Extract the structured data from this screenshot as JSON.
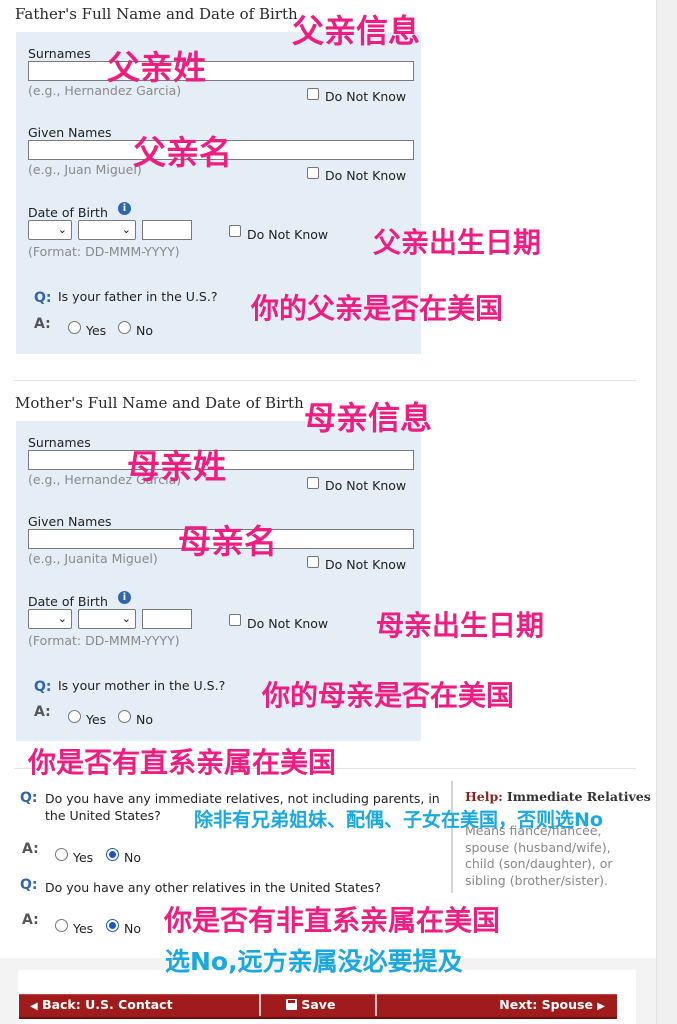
{
  "father": {
    "section_title": "Father's Full Name and Date of Birth",
    "surnames_label": "Surnames",
    "surnames_hint": "(e.g., Hernandez Garcia)",
    "given_label": "Given Names",
    "given_hint": "(e.g., Juan Miguel)",
    "dob_label": "Date of Birth",
    "dob_format": "(Format: DD-MMM-YYYY)",
    "do_not_know": "Do Not Know",
    "question": "Is your father in the U.S.?",
    "yes": "Yes",
    "no": "No"
  },
  "mother": {
    "section_title": "Mother's Full Name and Date of Birth",
    "surnames_label": "Surnames",
    "surnames_hint": "(e.g., Hernandez Garcia)",
    "given_label": "Given Names",
    "given_hint": "(e.g., Juanita Miguel)",
    "dob_label": "Date of Birth",
    "dob_format": "(Format: DD-MMM-YYYY)",
    "do_not_know": "Do Not Know",
    "question": "Is your mother in the U.S.?",
    "yes": "Yes",
    "no": "No"
  },
  "relatives": {
    "q1": "Do you have any immediate relatives, not including parents, in the United States?",
    "q1_yes": "Yes",
    "q1_no": "No",
    "q1_selected": "No",
    "q2": "Do you have any other relatives in the United States?",
    "q2_yes": "Yes",
    "q2_no": "No",
    "q2_selected": "No"
  },
  "qa": {
    "q": "Q:",
    "a": "A:"
  },
  "help": {
    "prefix": "Help:",
    "title": "Immediate Relatives",
    "body": "Means fiancé/fiancée, spouse (husband/wife), child (son/daughter), or sibling (brother/sister)."
  },
  "nav": {
    "back": "Back: U.S. Contact",
    "save": "Save",
    "next": "Next: Spouse"
  },
  "annotations": {
    "father_info": "父亲信息",
    "father_surname": "父亲姓",
    "father_given": "父亲名",
    "father_dob": "父亲出生日期",
    "father_in_us": "你的父亲是否在美国",
    "mother_info": "母亲信息",
    "mother_surname": "母亲姓",
    "mother_given": "母亲名",
    "mother_dob": "母亲出生日期",
    "mother_in_us": "你的母亲是否在美国",
    "immediate": "你是否有直系亲属在美国",
    "immediate_note": "除非有兄弟姐妹、配偶、子女在美国，否则选No",
    "other": "你是否有非直系亲属在美国",
    "other_note": "选No,远方亲属没必要提及"
  },
  "colors": {
    "annotation_pink": "#ee1d82",
    "annotation_blue": "#19a8e0",
    "nav_red": "#a01c1c",
    "panel_blue": "#e5edf6",
    "q_blue": "#2f66b1"
  },
  "icons": [
    "help-icon",
    "chevron-down-icon",
    "arrow-left-icon",
    "save-icon",
    "arrow-right-icon"
  ]
}
